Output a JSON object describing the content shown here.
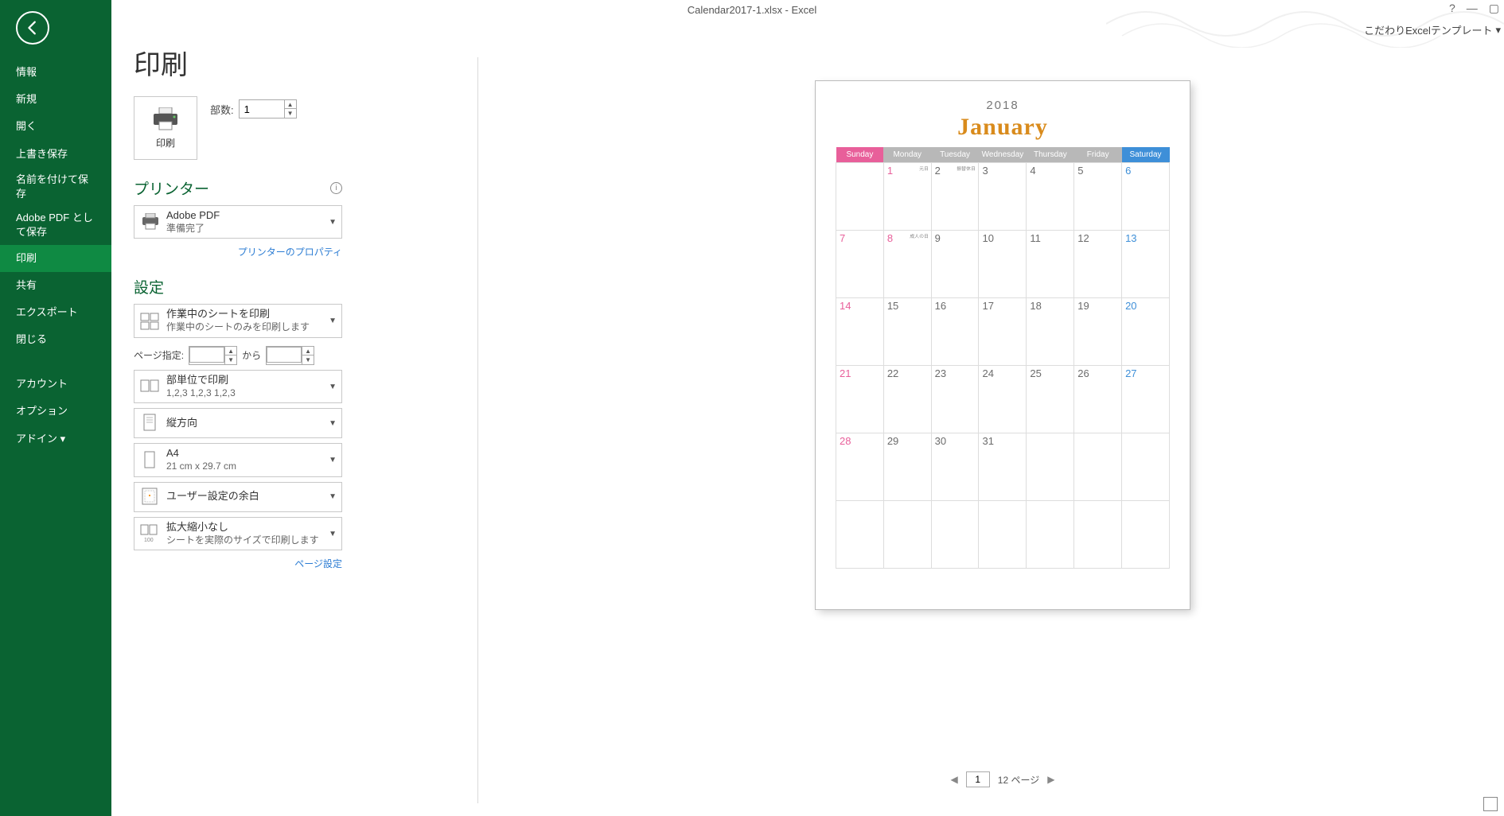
{
  "window": {
    "title": "Calendar2017-1.xlsx - Excel",
    "ribbon_right": "こだわりExcelテンプレート",
    "help": "?",
    "min": "—",
    "max": "▢"
  },
  "back_label": "←",
  "nav": {
    "info": "情報",
    "new": "新規",
    "open": "開く",
    "save": "上書き保存",
    "saveas": "名前を付けて保存",
    "adobe": "Adobe PDF として保存",
    "print": "印刷",
    "share": "共有",
    "export": "エクスポート",
    "close": "閉じる",
    "account": "アカウント",
    "options": "オプション",
    "addin": "アドイン ▾"
  },
  "print": {
    "page_title": "印刷",
    "button_label": "印刷",
    "copies_label": "部数:",
    "copies_value": "1"
  },
  "printer": {
    "section": "プリンター",
    "name": "Adobe PDF",
    "status": "準備完了",
    "props_link": "プリンターのプロパティ"
  },
  "settings": {
    "section": "設定",
    "what": {
      "title": "作業中のシートを印刷",
      "sub": "作業中のシートのみを印刷します"
    },
    "pages_label": "ページ指定:",
    "pages_to": "から",
    "collate": {
      "title": "部単位で印刷",
      "sub": "1,2,3   1,2,3   1,2,3"
    },
    "orientation": {
      "title": "縦方向"
    },
    "paper": {
      "title": "A4",
      "sub": "21 cm x 29.7 cm"
    },
    "margins": {
      "title": "ユーザー設定の余白"
    },
    "scale": {
      "title": "拡大縮小なし",
      "sub": "シートを実際のサイズで印刷します"
    },
    "page_setup_link": "ページ設定"
  },
  "preview_nav": {
    "page_input": "1",
    "page_total": "12 ページ"
  },
  "calendar": {
    "year": "2018",
    "month": "January",
    "days": {
      "sun": "Sunday",
      "mon": "Monday",
      "tue": "Tuesday",
      "wed": "Wednesday",
      "thu": "Thursday",
      "fri": "Friday",
      "sat": "Saturday"
    },
    "notes": {
      "ganjitsu": "元日",
      "furikae": "振替休日",
      "seijin": "成人の日"
    },
    "weeks": [
      [
        {
          "n": ""
        },
        {
          "n": "1",
          "hol": true,
          "note": "ganjitsu"
        },
        {
          "n": "2",
          "note": "furikae"
        },
        {
          "n": "3"
        },
        {
          "n": "4"
        },
        {
          "n": "5"
        },
        {
          "n": "6"
        }
      ],
      [
        {
          "n": "7"
        },
        {
          "n": "8",
          "hol": true,
          "note": "seijin"
        },
        {
          "n": "9"
        },
        {
          "n": "10"
        },
        {
          "n": "11"
        },
        {
          "n": "12"
        },
        {
          "n": "13"
        }
      ],
      [
        {
          "n": "14"
        },
        {
          "n": "15"
        },
        {
          "n": "16"
        },
        {
          "n": "17"
        },
        {
          "n": "18"
        },
        {
          "n": "19"
        },
        {
          "n": "20"
        }
      ],
      [
        {
          "n": "21"
        },
        {
          "n": "22"
        },
        {
          "n": "23"
        },
        {
          "n": "24"
        },
        {
          "n": "25"
        },
        {
          "n": "26"
        },
        {
          "n": "27"
        }
      ],
      [
        {
          "n": "28"
        },
        {
          "n": "29"
        },
        {
          "n": "30"
        },
        {
          "n": "31"
        },
        {
          "n": ""
        },
        {
          "n": ""
        },
        {
          "n": ""
        }
      ],
      [
        {
          "n": ""
        },
        {
          "n": ""
        },
        {
          "n": ""
        },
        {
          "n": ""
        },
        {
          "n": ""
        },
        {
          "n": ""
        },
        {
          "n": ""
        }
      ]
    ]
  }
}
